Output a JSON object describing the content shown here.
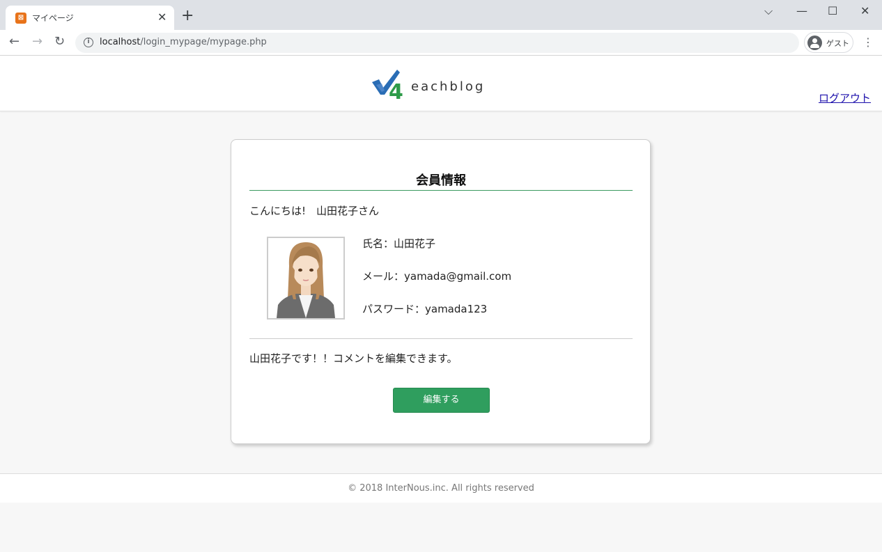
{
  "browser": {
    "tab_title": "マイページ",
    "tab_close": "✕",
    "new_tab": "+",
    "window_controls": {
      "dropdown": "⌵",
      "minimize": "—",
      "maximize": "☐",
      "close": "✕"
    },
    "nav": {
      "back": "←",
      "forward": "→",
      "reload": "↻"
    },
    "url_host": "localhost",
    "url_path": "/login_mypage/mypage.php",
    "profile_label": "ゲスト",
    "menu": "⋮"
  },
  "header": {
    "logo_text": "eachblog",
    "logout_label": "ログアウト"
  },
  "card": {
    "title": "会員情報",
    "greeting": "こんにちは!　山田花子さん",
    "name_line": "氏名：山田花子",
    "mail_line": "メール：yamada@gmail.com",
    "password_line": "パスワード：yamada123",
    "comment": "山田花子です！！コメントを編集できます。",
    "edit_label": "編集する"
  },
  "footer": {
    "copyright": "© 2018 InterNous.inc. All rights reserved"
  },
  "colors": {
    "accent_green": "#2f9e5e",
    "link_blue": "#1a0dab",
    "tab_favicon": "#e8731a"
  }
}
